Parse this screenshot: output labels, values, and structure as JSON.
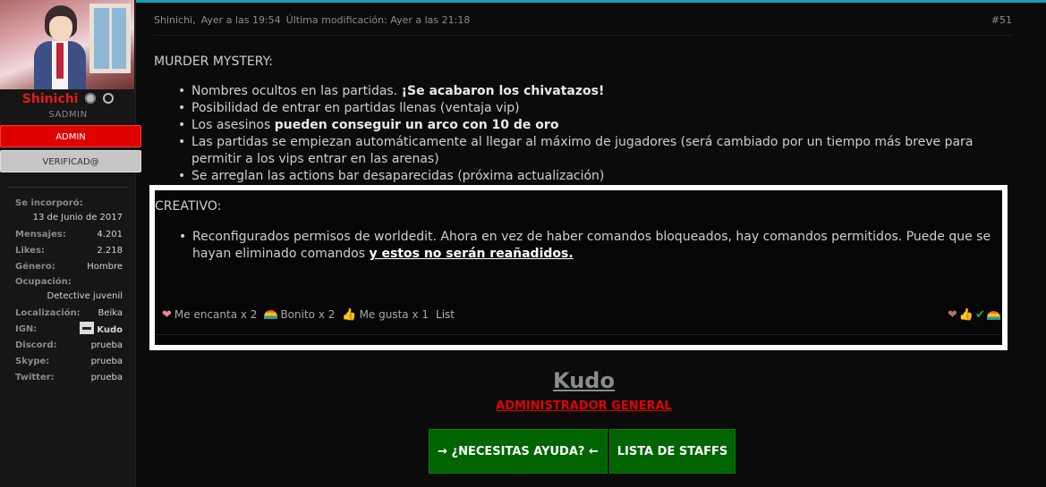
{
  "sidebar": {
    "username": "Shinichi",
    "rank": "SADMIN",
    "banners": {
      "admin": "ADMIN",
      "verified": "VERIFICAD@"
    },
    "stats": {
      "joined_label": "Se incorporó:",
      "joined_value": "13 de Junio de 2017",
      "messages_label": "Mensajes:",
      "messages_value": "4.201",
      "likes_label": "Likes:",
      "likes_value": "2.218",
      "gender_label": "Género:",
      "gender_value": "Hombre",
      "occupation_label": "Ocupación:",
      "occupation_value": "Detective juvenil",
      "location_label": "Localización:",
      "location_value": "Beika",
      "ign_label": "IGN:",
      "ign_value": "Kudo",
      "discord_label": "Discord:",
      "discord_value": "prueba",
      "skype_label": "Skype:",
      "skype_value": "prueba",
      "twitter_label": "Twitter:",
      "twitter_value": "prueba"
    }
  },
  "post": {
    "author": "Shinichi,",
    "time": "Ayer a las 19:54",
    "modified": "Última modificación: Ayer a las 21:18",
    "number": "#51",
    "murder": {
      "title": "MURDER MYSTERY:",
      "items": [
        {
          "text": "Nombres ocultos en las partidas. ",
          "bold": "¡Se acabaron los chivatazos!"
        },
        {
          "text": "Posibilidad de entrar en partidas llenas (ventaja vip)",
          "bold": ""
        },
        {
          "text": "Los asesinos ",
          "bold": "pueden conseguir un arco con 10 de oro"
        },
        {
          "text": "Las partidas se empiezan automáticamente al llegar al máximo de jugadores (será cambiado por un tiempo más breve para permitir a los vips entrar en las arenas)",
          "bold": ""
        },
        {
          "text": "Se arreglan las actions bar desaparecidas (próxima actualización)",
          "bold": ""
        }
      ]
    },
    "creativo": {
      "title": "CREATIVO:",
      "item_text": "Reconfigurados permisos de worldedit. Ahora en vez de haber comandos bloqueados, hay comandos permitidos. Puede que se hayan eliminado comandos ",
      "item_link": "y estos no serán reañadidos."
    },
    "reactions": {
      "love": "Me encanta x 2",
      "pretty": "Bonito x 2",
      "like": "Me gusta x 1",
      "list": "List"
    }
  },
  "signature": {
    "name": "Kudo",
    "role": "ADMINISTRADOR GENERAL",
    "help_button": "→ ¿NECESITAS AYUDA? ←",
    "staff_button": "LISTA DE STAFFS"
  },
  "colors": {
    "accent_line": "#16a0b8",
    "username": "#e41b1b",
    "button_green": "#006400"
  }
}
